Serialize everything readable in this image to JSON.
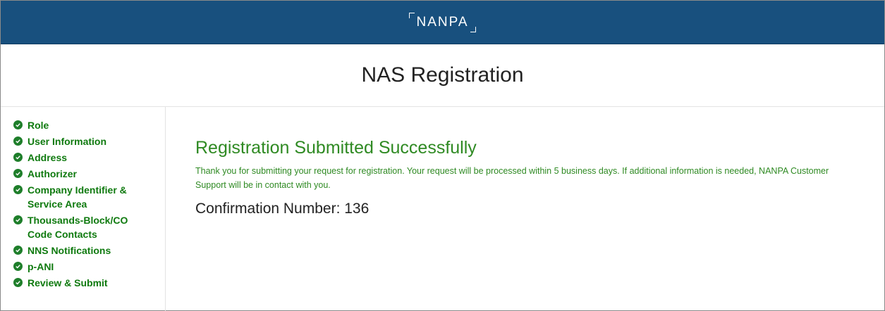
{
  "header": {
    "brand": "NANPA"
  },
  "page": {
    "title": "NAS Registration"
  },
  "sidebar": {
    "steps": [
      {
        "label": "Role"
      },
      {
        "label": "User Information"
      },
      {
        "label": "Address"
      },
      {
        "label": "Authorizer"
      },
      {
        "label": "Company Identifier & Service Area"
      },
      {
        "label": "Thousands-Block/CO Code Contacts"
      },
      {
        "label": "NNS Notifications"
      },
      {
        "label": "p-ANI"
      },
      {
        "label": "Review & Submit"
      }
    ]
  },
  "main": {
    "success_title": "Registration Submitted Successfully",
    "success_message": "Thank you for submitting your request for registration. Your request will be processed within 5 business days. If additional information is needed, NANPA Customer Support will be in contact with you.",
    "confirmation_label": "Confirmation Number: 136"
  },
  "colors": {
    "header_bg": "#18507e",
    "success_green": "#2f8a23",
    "step_green": "#0f7a0f",
    "check_icon": "#1e7e2a"
  },
  "icons": {
    "step_status": "check-circle-icon"
  }
}
